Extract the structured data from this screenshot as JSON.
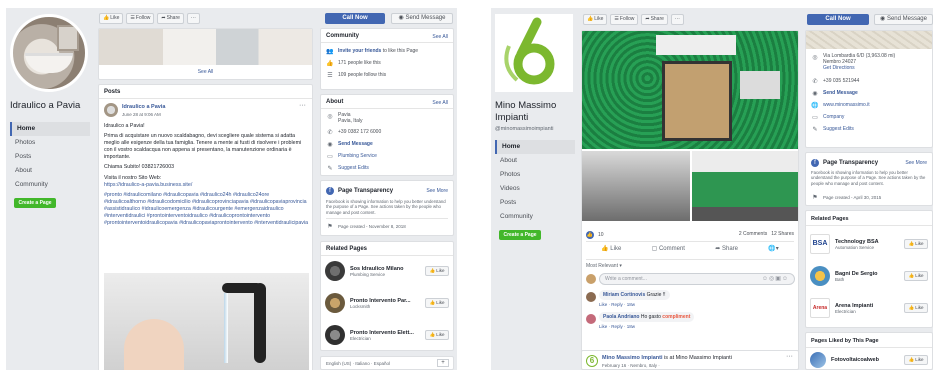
{
  "left": {
    "page_name": "Idraulico a Pavia",
    "nav": [
      "Home",
      "Photos",
      "Posts",
      "About",
      "Community"
    ],
    "create_page": "Create a Page",
    "toolbar": {
      "like": "Like",
      "follow": "Follow",
      "share": "Share",
      "more": "···"
    },
    "call_now": "Call Now",
    "send_message": "Send Message",
    "see_all": "See All",
    "posts_header": "Posts",
    "post": {
      "author": "Idraulico a Pavia",
      "date": "June 28 at 9:06 AM",
      "greeting": "Idraulico a Pavia!",
      "body": "Prima di acquistare un nuovo scaldabagno, devi scegliere quale sistema si adatta meglio alle esigenze della tua famiglia. Tenere a mente ai fusti di risolvere i problemi con il vostro scaldacqua non appena si presentano, la manutenzione ordinaria è importante.",
      "phone": "Chiama Subito! 03821726003",
      "visit": "Visita il nostro Sito Web:",
      "url": "https://idraulico-a-pavia.business.site/",
      "hashtags": "#pronto #idraulicomilano #idraulicopavia #idraulico24h #idraulico24ore #idraulicoalthorno #idraulicodomicilio #idraulicoprovinciapavia #idraulicopaviaprovincia #assistidraulico #idraulicoemergenza #idraulicourgente #emergenzaidraulico #interventidraulici #prontointerventoidraulico #idraulicoprontointervento #prontointerventoidraulicopavia #idraulicopaviaprontointervento #interventidraulicipavia"
    },
    "community": {
      "title": "Community",
      "see_all": "See All",
      "invite": "Invite your friends",
      "invite_suffix": "to like this Page",
      "likes": "171 people like this",
      "follows": "109 people follow this"
    },
    "about": {
      "title": "About",
      "see_all": "See All",
      "location": "Pavia",
      "location2": "Pavia, Italy",
      "phone": "+39 0382 172 6000",
      "send_message": "Send Message",
      "category": "Plumbing Service",
      "suggest": "Suggest Edits"
    },
    "transparency": {
      "title": "Page Transparency",
      "see_more": "See More",
      "text": "Facebook is showing information to help you better understand the purpose of a Page. See actions taken by the people who manage and post content.",
      "created": "Page created - November 8, 2018"
    },
    "related": {
      "title": "Related Pages",
      "items": [
        {
          "name": "Sos Idraulico Milano",
          "cat": "Plumbing Service"
        },
        {
          "name": "Pronto Intervento Par...",
          "cat": "Locksmith"
        },
        {
          "name": "Pronto Intervento Elett...",
          "cat": "Electrician"
        }
      ],
      "like": "Like"
    },
    "footer": "English (US) · Italiano · Español",
    "colors": {
      "fb_blue": "#4267b2",
      "green": "#42b72a"
    }
  },
  "right": {
    "page_name": "Mino Massimo Impianti",
    "handle": "@minomassimoimpianti",
    "nav": [
      "Home",
      "About",
      "Photos",
      "Videos",
      "Posts",
      "Community"
    ],
    "create_page": "Create a Page",
    "toolbar": {
      "like": "Like",
      "follow": "Follow",
      "share": "Share",
      "more": "···"
    },
    "call_now": "Call Now",
    "send_message": "Send Message",
    "address": "Via Lombardia 6/D (3,963.08 mi)",
    "address2": "Nembro 24027",
    "directions": "Get Directions",
    "phone": "+39 035 521944",
    "send_msg": "Send Message",
    "website": "www.minomassimo.it",
    "category": "Company",
    "suggest": "Suggest Edits",
    "transparency": {
      "title": "Page Transparency",
      "see_more": "See More",
      "text": "Facebook is showing information to help you better understand the purpose of a Page. See actions taken by the people who manage and post content.",
      "created": "Page created - April 30, 2015"
    },
    "related": {
      "title": "Related Pages",
      "items": [
        {
          "name": "Technology BSA",
          "cat": "Automation Service"
        },
        {
          "name": "Bagni De Sergio",
          "cat": "Bath"
        },
        {
          "name": "Arena Impianti",
          "cat": "Electrician"
        }
      ],
      "like": "Like"
    },
    "liked_by": "Pages Liked by This Page",
    "liked_item": "Fotovoltaicoalweb",
    "post_stats": {
      "reactions": "10",
      "comments": "2 Comments",
      "shares": "12 Shares"
    },
    "actions": {
      "like": "Like",
      "comment": "Comment",
      "share": "Share"
    },
    "most_relevant": "Most Relevant ▾",
    "write_comment": "Write a comment...",
    "comments": [
      {
        "author": "Miriam Cortinovis",
        "text": "Grazie !!",
        "meta": "Like · Reply · 18w"
      },
      {
        "author": "Paola Andriano",
        "text": "Ho gasto",
        "highlight": "compliment",
        "meta": "Like · Reply · 18w"
      }
    ],
    "bottom_post": {
      "author": "Mino Massimo Impianti",
      "text": "is at Mino Massimo Impianti",
      "date": "February 16 · Nembro, Italy ·"
    },
    "colors": {
      "logo_green": "#7cb82f"
    }
  }
}
